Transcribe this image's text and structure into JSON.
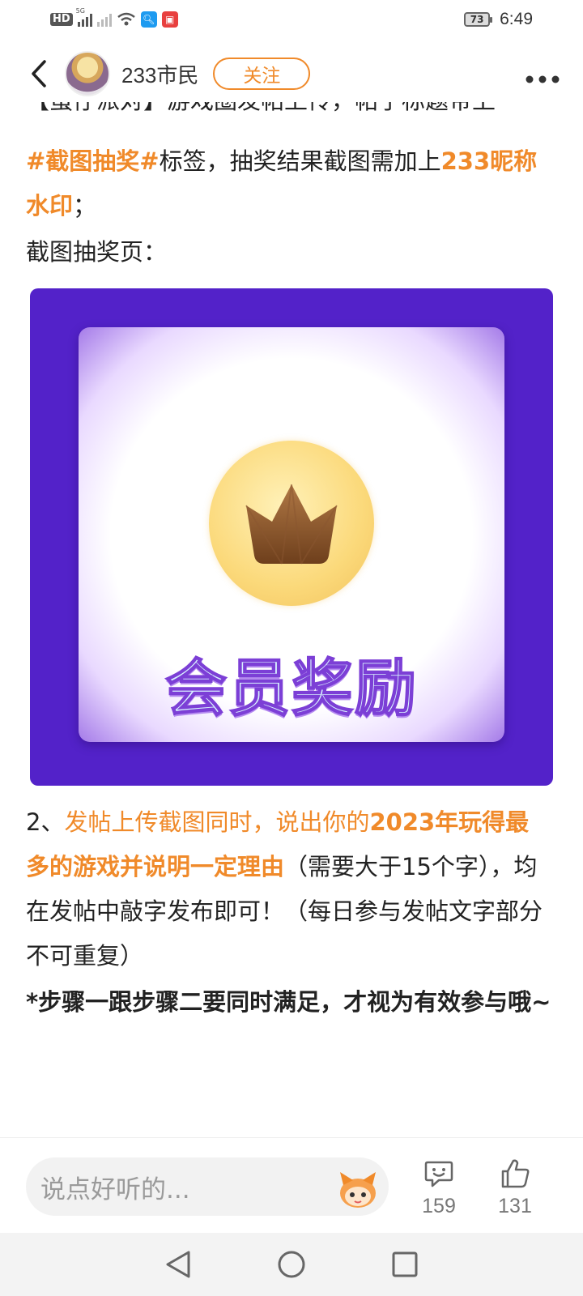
{
  "status_bar": {
    "hd": "HD",
    "net": "5G",
    "battery": "73",
    "time": "6:49"
  },
  "header": {
    "username": "233市民",
    "follow_label": "关注"
  },
  "article": {
    "cut_line": "【蛋仔派对】游戏圈发帖上传，帖子标题带上",
    "p1_hashtag": "#截图抽奖#",
    "p1_mid": "标签，抽奖结果截图需加上",
    "p1_watermark": "233昵称水印",
    "p1_end": "；",
    "p2": "截图抽奖页："
  },
  "promo_image": {
    "title": "会员奖励"
  },
  "article2": {
    "step_num": "2、",
    "step_orange": "发帖上传截图同时，说出你的",
    "step_bold": "2023年玩得最多的游戏并说明一定理由",
    "step_rest": "（需要大于15个字），均在发帖中敲字发布即可！（每日参与发帖文字部分不可重复）",
    "note": "*步骤一跟步骤二要同时满足，才视为有效参与哦~"
  },
  "bottom_bar": {
    "comment_placeholder": "说点好听的...",
    "emoji_count": "159",
    "like_count": "131"
  },
  "colors": {
    "accent": "#f08a2a",
    "promo_bg": "#5322c9"
  }
}
